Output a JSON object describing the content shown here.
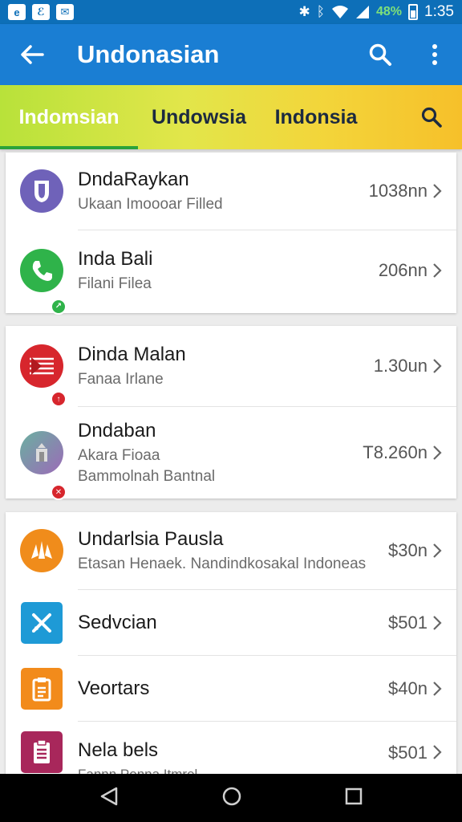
{
  "status_bar": {
    "battery": "48%",
    "time": "1:35",
    "app_icons": [
      "e-icon",
      "dj-icon",
      "message-icon"
    ]
  },
  "app_bar": {
    "title": "Undonasian"
  },
  "tabs": [
    {
      "label": "Indomsian",
      "active": true
    },
    {
      "label": "Undowsia",
      "active": false
    },
    {
      "label": "Indonsia",
      "active": false
    }
  ],
  "groups": [
    {
      "items": [
        {
          "title": "DndaRaykan",
          "subtitle": "Ukaan Imoooar Filled",
          "value": "1038nn",
          "icon": "shield-icon",
          "color": "#6f62b9"
        },
        {
          "title": "Inda Bali",
          "subtitle": "Filani Filea",
          "value": "206nn",
          "icon": "phone-icon",
          "color": "#2fb34a"
        }
      ]
    },
    {
      "items": [
        {
          "title": "Dinda Malan",
          "subtitle": "Fanaa Irlane",
          "value": "1.30un",
          "icon": "flag-icon",
          "color": "#d7262d"
        },
        {
          "title": "Dndaban",
          "subtitle": "Akara Fioaa",
          "subtitle2": "Bammolnah Bantnal",
          "value": "T8.260n",
          "icon": "temple-icon",
          "color": "#8b6bb3"
        }
      ]
    },
    {
      "items": [
        {
          "title": "Undarlsia Pausla",
          "subtitle": "Etasan Henaek. Nandindkosakal Indoneas",
          "value": "$30n",
          "icon": "hands-icon",
          "color": "#f08c1b"
        },
        {
          "title": "Sedvcian",
          "value": "$501",
          "icon": "tools-icon",
          "color": "#1e9ad6"
        },
        {
          "title": "Veortars",
          "value": "$40n",
          "icon": "document-icon",
          "color": "#f28b1b"
        },
        {
          "title": "Nela bels",
          "subtitle": "Fannn Ponna Itmrel",
          "value": "$501",
          "icon": "clipboard-icon",
          "color": "#a8275b"
        }
      ]
    }
  ]
}
